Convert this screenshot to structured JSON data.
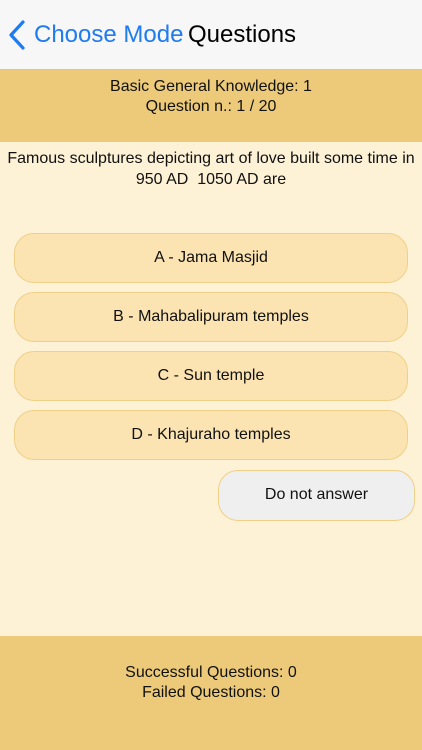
{
  "nav": {
    "back_label": "Choose Mode",
    "title": "Questions",
    "back_color": "#1e7bf2"
  },
  "header": {
    "category": "Basic General Knowledge: 1",
    "progress": "Question n.: 1 / 20"
  },
  "question": {
    "line1": "Famous sculptures depicting art of love built some time in",
    "line2": "950 AD  1050 AD are"
  },
  "answers": [
    {
      "label": "A - Jama Masjid"
    },
    {
      "label": "B - Mahabalipuram temples"
    },
    {
      "label": "C - Sun temple"
    },
    {
      "label": "D - Khajuraho temples"
    }
  ],
  "skip_label": "Do not answer",
  "footer": {
    "successful": "Successful Questions: 0",
    "failed": "Failed Questions: 0"
  },
  "colors": {
    "band": "#ecca7a",
    "background": "#fdf1d6",
    "answer_fill": "#fbe4b2",
    "skip_fill": "#efefef"
  }
}
